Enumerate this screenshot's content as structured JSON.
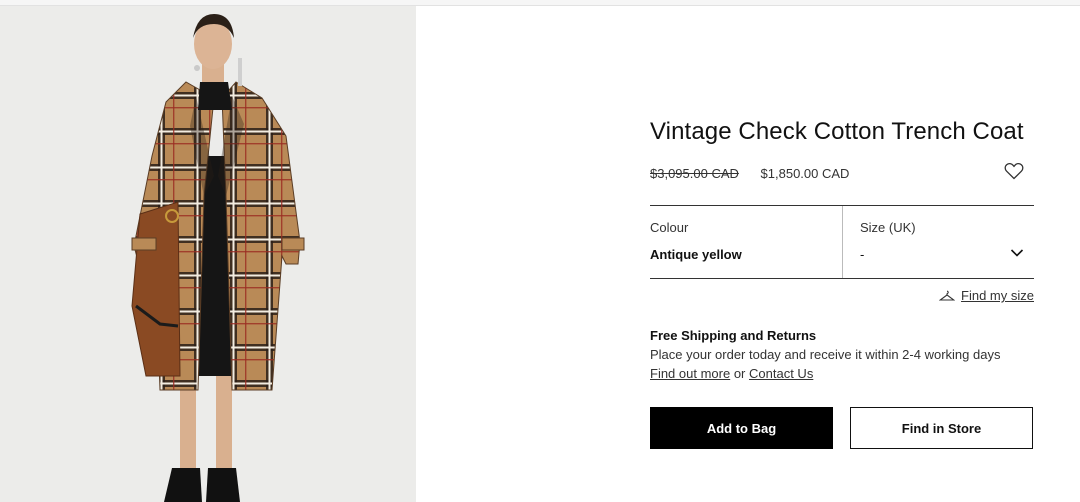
{
  "product": {
    "title": "Vintage Check Cotton Trench Coat",
    "price_old": "$3,095.00 CAD",
    "price_new": "$1,850.00 CAD",
    "image_alt": "Model wearing vintage check trench coat"
  },
  "options": {
    "colour_label": "Colour",
    "colour_value": "Antique yellow",
    "size_label": "Size (UK)",
    "size_value": "-"
  },
  "find_size": "Find my size",
  "shipping": {
    "title": "Free Shipping and Returns",
    "text": "Place your order today and receive it within 2-4 working days",
    "link1": "Find out more",
    "connector": "or",
    "link2": "Contact Us"
  },
  "buttons": {
    "add_to_bag": "Add to Bag",
    "find_in_store": "Find in Store"
  },
  "colors": {
    "primary": "#000000",
    "background": "#ffffff",
    "check_tan": "#b98a57"
  },
  "icons": [
    "heart-icon",
    "chevron-down-icon",
    "hanger-icon"
  ]
}
